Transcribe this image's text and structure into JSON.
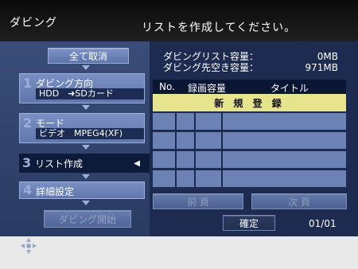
{
  "header": {
    "title": "ダビング",
    "message": "リストを作成してください。"
  },
  "left": {
    "clear_all": "全て取消",
    "steps": [
      {
        "num": "1",
        "label": "ダビング方向",
        "value": "HDD　➜SDカード"
      },
      {
        "num": "2",
        "label": "モード",
        "value": "ビデオ　MPEG4(XF)"
      },
      {
        "num": "3",
        "label": "リスト作成"
      },
      {
        "num": "4",
        "label": "詳細設定"
      }
    ],
    "start_button": "ダビング開始"
  },
  "info": {
    "list_capacity_label": "ダビングリスト容量：",
    "list_capacity_value": "0MB",
    "free_capacity_label": "ダビング先空き容量：",
    "free_capacity_value": "971MB"
  },
  "table": {
    "headers": [
      "No.",
      "録画容量",
      "タイトル"
    ],
    "new_entry": "新 規 登 録"
  },
  "pager": {
    "prev": "前 頁",
    "next": "次 頁",
    "confirm": "確定",
    "page": "01/01"
  },
  "colors": {
    "panel": "#1c2b4f",
    "highlight": "#e6e58e",
    "button": "#6f86bc"
  }
}
